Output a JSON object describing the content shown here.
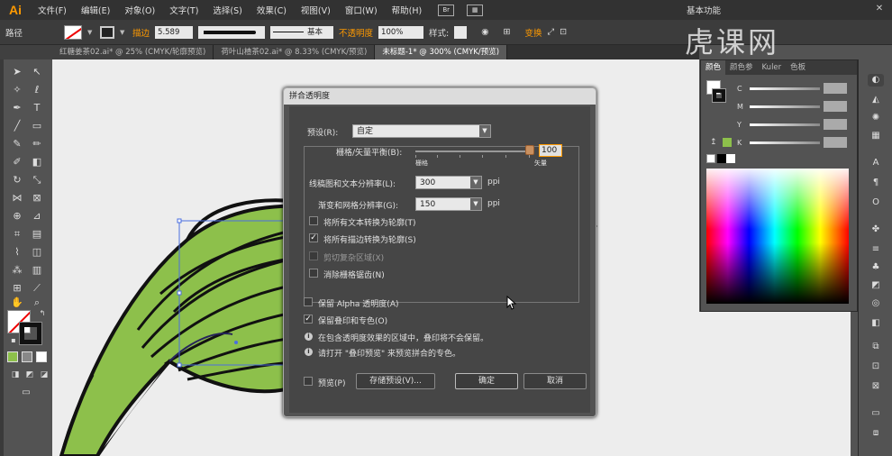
{
  "app": {
    "logo": "Ai",
    "workspace": "基本功能",
    "watermark": "虎课网"
  },
  "menu": [
    "文件(F)",
    "编辑(E)",
    "对象(O)",
    "文字(T)",
    "选择(S)",
    "效果(C)",
    "视图(V)",
    "窗口(W)",
    "帮助(H)"
  ],
  "menu_badges": {
    "bridge": "Br"
  },
  "control": {
    "object_type": "路径",
    "stroke_label": "描边",
    "stroke_value": "5.589",
    "profile_label": "基本",
    "opacity_label": "不透明度",
    "opacity_value": "100%",
    "style_label": "样式:",
    "transform_label": "变换"
  },
  "tabs": [
    {
      "label": "红糖姜茶02.ai* @ 25% (CMYK/轮廓预览)",
      "active": false
    },
    {
      "label": "荷叶山楂茶02.ai* @ 8.33% (CMYK/预览)",
      "active": false
    },
    {
      "label": "未标题-1* @ 300% (CMYK/预览)",
      "active": true
    }
  ],
  "color_panel": {
    "tabs": [
      "颜色",
      "颜色参",
      "Kuler",
      "色板"
    ],
    "channels": [
      "C",
      "M",
      "Y",
      "K"
    ],
    "accent": "#8dc04b"
  },
  "dialog": {
    "title": "拼合透明度",
    "preset_label": "预设(R):",
    "preset_value": "自定",
    "balance_label": "栅格/矢量平衡(B):",
    "balance_value": "100",
    "balance_min_label": "栅格",
    "balance_max_label": "矢量",
    "line_art_label": "线稿图和文本分辨率(L):",
    "line_art_value": "300",
    "line_art_unit": "ppi",
    "gradient_label": "渐变和网格分辨率(G):",
    "gradient_value": "150",
    "gradient_unit": "ppi",
    "options": [
      {
        "label": "将所有文本转换为轮廓(T)",
        "checked": false,
        "disabled": false
      },
      {
        "label": "将所有描边转换为轮廓(S)",
        "checked": true,
        "disabled": false
      },
      {
        "label": "剪切复杂区域(X)",
        "checked": false,
        "disabled": true
      },
      {
        "label": "消除栅格锯齿(N)",
        "checked": false,
        "disabled": false
      }
    ],
    "preserve_alpha": "保留 Alpha 透明度(A)",
    "preserve_overprint": "保留叠印和专色(O)",
    "info1": "在包含透明度效果的区域中，叠印将不会保留。",
    "info2": "请打开 \"叠印预览\" 来预览拼合的专色。",
    "preview_label": "预览(P)",
    "save_preset_label": "存储预设(V)...",
    "ok_label": "确定",
    "cancel_label": "取消"
  }
}
